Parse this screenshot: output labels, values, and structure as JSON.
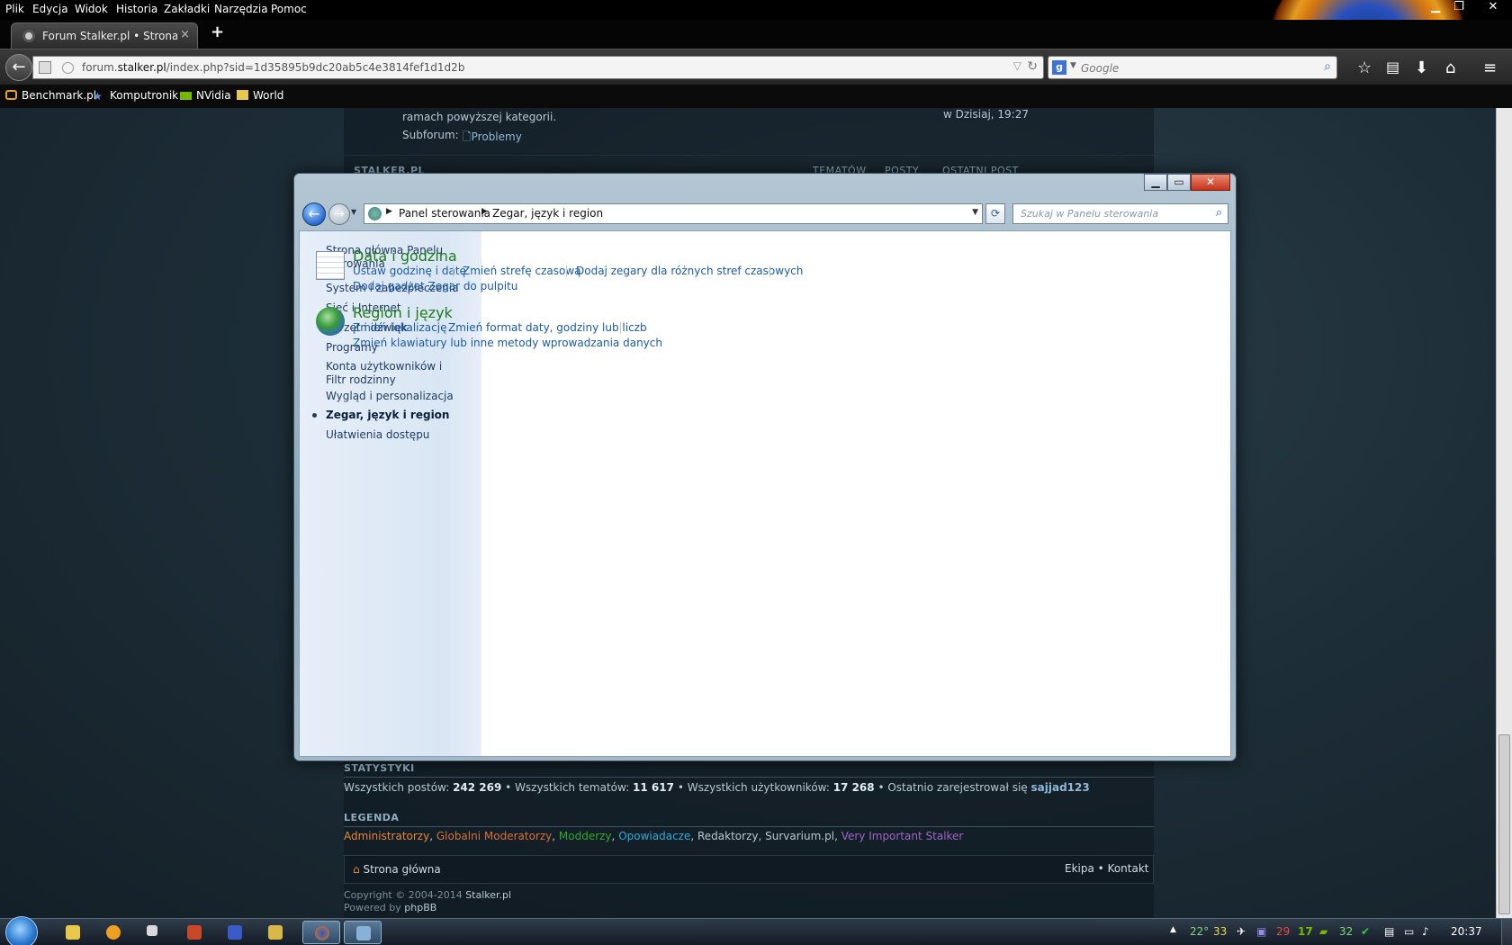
{
  "browser": {
    "menu": [
      "Plik",
      "Edycja",
      "Widok",
      "Historia",
      "Zakładki",
      "Narzędzia",
      "Pomoc"
    ],
    "tab_title": "Forum Stalker.pl • Strona g...",
    "tab_close": "×",
    "new_tab": "+",
    "url_prefix": "forum.",
    "url_host": "stalker.pl",
    "url_path": "/index.php?sid=1d35895b9dc20ab5c4e3814fef1d1d2b",
    "search_placeholder": "Google",
    "bookmarks": [
      "Benchmark.pl",
      "Komputronik",
      "NVidia",
      "World"
    ]
  },
  "forum": {
    "top_desc": "ramach powyższej kategorii.",
    "subforum_label": "Subforum:",
    "subforum_link": "Problemy",
    "last_post_time": "w Dzisiaj, 19:27",
    "section_header": "STALKER.PL",
    "col_topics": "TEMATÓW",
    "col_posts": "POSTY",
    "col_last": "OSTATNI POST",
    "stats_header": "STATYSTYKI",
    "stats": {
      "posts_label": "Wszystkich postów:",
      "posts_value": "242 269",
      "topics_label": "• Wszystkich tematów:",
      "topics_value": "11 617",
      "users_label": "• Wszystkich użytkowników:",
      "users_value": "17 268",
      "newest_label": "• Ostatnio zarejestrował się",
      "newest_user": "sajjad123"
    },
    "legend_header": "LEGENDA",
    "legend": [
      {
        "name": "Administratorzy",
        "color": "#e8873a"
      },
      {
        "name": "Globalni Moderatorzy",
        "color": "#d8703a"
      },
      {
        "name": "Modderzy",
        "color": "#33a833"
      },
      {
        "name": "Opowiadacze",
        "color": "#2faad8"
      },
      {
        "name": "Redaktorzy",
        "color": "#b8c8d2"
      },
      {
        "name": "Survarium.pl",
        "color": "#b8c8d2"
      },
      {
        "name": "Very Important Stalker",
        "color": "#a064c8"
      }
    ],
    "home_link": "Strona główna",
    "team_link": "Ekipa",
    "contact_link": "Kontakt",
    "copyright_text": "Copyright © 2004-2014",
    "copyright_site": "Stalker.pl",
    "powered_text": "Powered by",
    "powered_link": "phpBB"
  },
  "control_panel": {
    "breadcrumb": [
      "Panel sterowania",
      "Zegar, język i region"
    ],
    "search_placeholder": "Szukaj w Panelu sterowania",
    "sidebar": [
      "Strona główna Panelu sterowania",
      "System i zabezpieczenia",
      "Sieć i Internet",
      "Sprzęt i dźwięk",
      "Programy",
      "Konta użytkowników i Filtr rodzinny",
      "Wygląd i personalizacja",
      "Zegar, język i region",
      "Ułatwienia dostępu"
    ],
    "categories": [
      {
        "title": "Data i godzina",
        "links": [
          "Ustaw godzinę i datę",
          "Zmień strefę czasową",
          "Dodaj zegary dla różnych stref czasowych",
          "Dodaj gadżet Zegar do pulpitu"
        ]
      },
      {
        "title": "Region i język",
        "links": [
          "Zmień lokalizację",
          "Zmień format daty, godziny lub liczb",
          "Zmień klawiatury lub inne metody wprowadzania danych"
        ]
      }
    ]
  },
  "taskbar": {
    "tray": [
      "22°",
      "33",
      "29",
      "17",
      "32"
    ],
    "clock": "20:37"
  }
}
